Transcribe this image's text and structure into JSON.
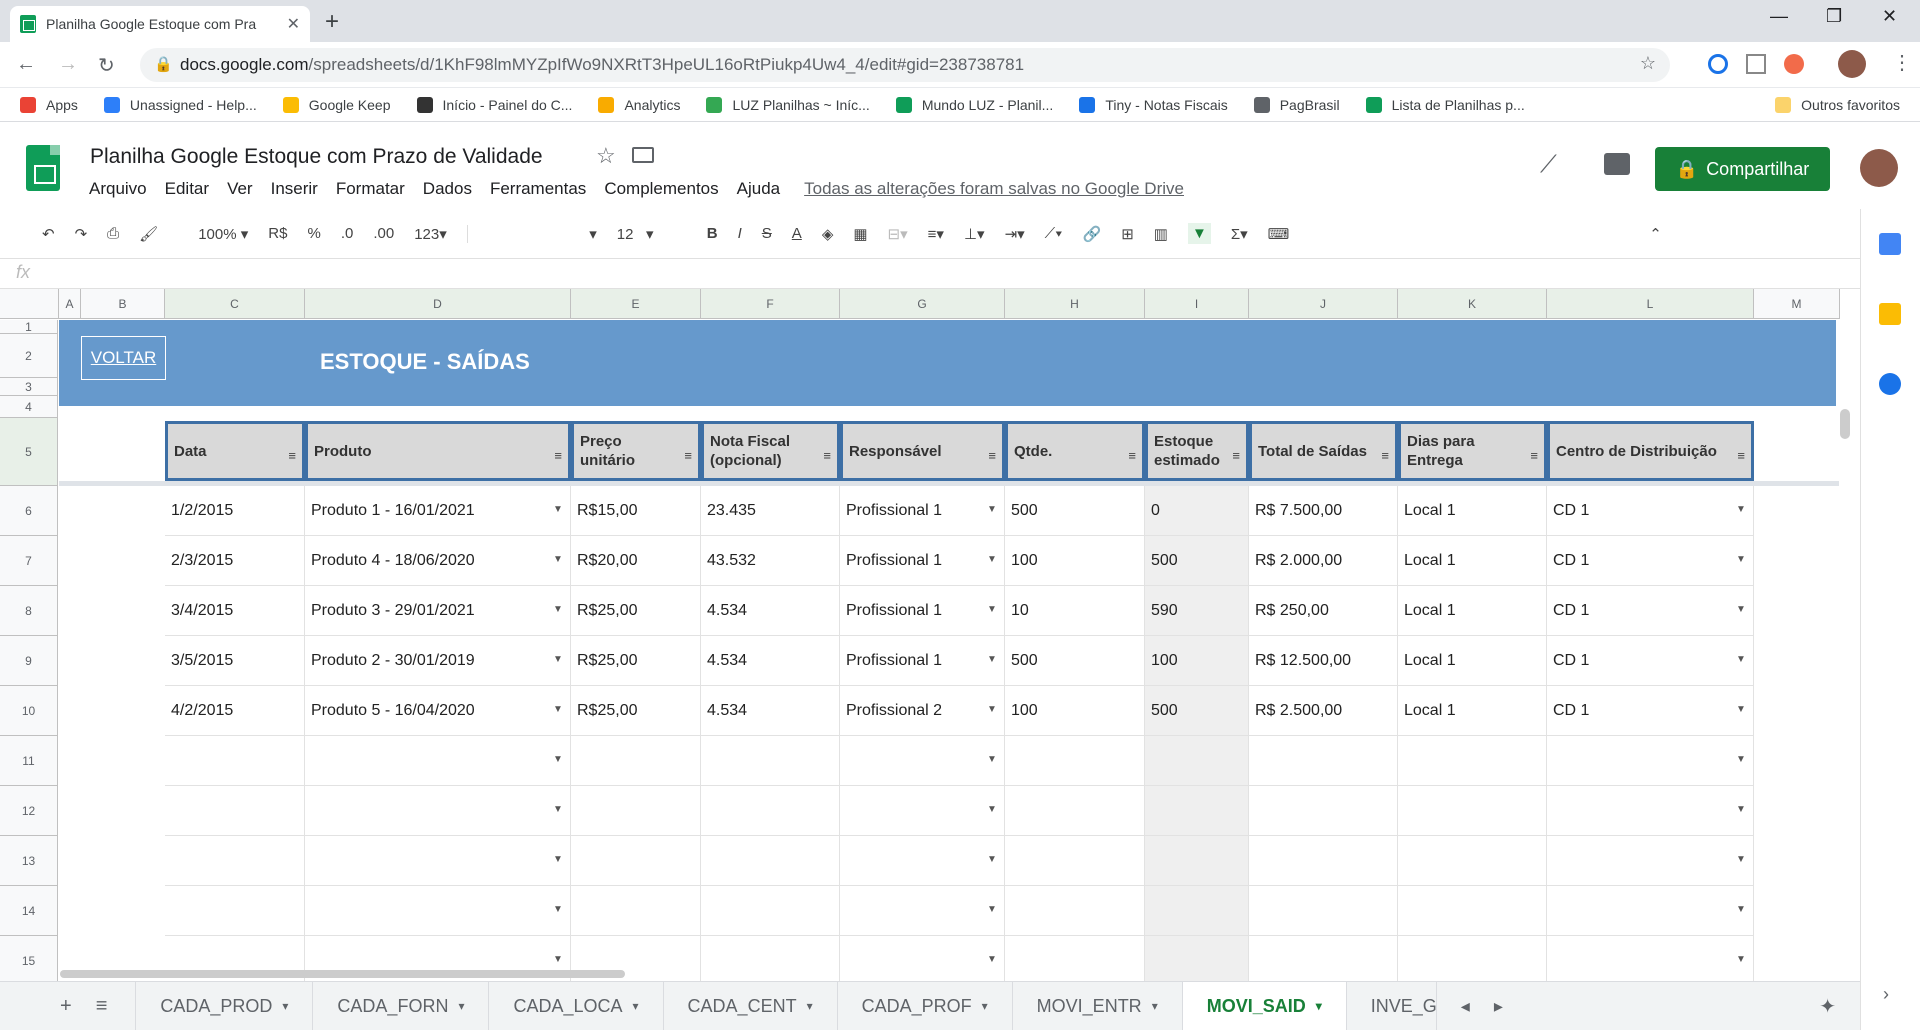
{
  "browser": {
    "tab_title": "Planilha Google Estoque com Pra",
    "url_host": "docs.google.com",
    "url_path": "/spreadsheets/d/1KhF98lmMYZpIfWo9NXRtT3HpeUL16oRtPiukp4Uw4_4/edit#gid=238738781"
  },
  "bookmarks": [
    {
      "label": "Apps",
      "color": "#ea4335"
    },
    {
      "label": "Unassigned - Help...",
      "color": "#2d7ff9"
    },
    {
      "label": "Google Keep",
      "color": "#fbbc04"
    },
    {
      "label": "Início - Painel do C...",
      "color": "#333333"
    },
    {
      "label": "Analytics",
      "color": "#f9ab00"
    },
    {
      "label": "LUZ Planilhas ~ Iníc...",
      "color": "#34a853"
    },
    {
      "label": "Mundo LUZ - Planil...",
      "color": "#0f9d58"
    },
    {
      "label": "Tiny - Notas Fiscais",
      "color": "#1a73e8"
    },
    {
      "label": "PagBrasil",
      "color": "#5f6368"
    },
    {
      "label": "Lista de Planilhas p...",
      "color": "#0f9d58"
    }
  ],
  "bookmarks_more": "Outros favoritos",
  "doc": {
    "title": "Planilha Google Estoque com Prazo de Validade",
    "menu": [
      "Arquivo",
      "Editar",
      "Ver",
      "Inserir",
      "Formatar",
      "Dados",
      "Ferramentas",
      "Complementos",
      "Ajuda"
    ],
    "saved": "Todas as alterações foram salvas no Google Drive",
    "share": "Compartilhar"
  },
  "toolbar": {
    "zoom": "100%",
    "currency": "R$",
    "percent": "%",
    "dec_less": ".0",
    "dec_more": ".00",
    "format": "123",
    "font_size": "12"
  },
  "fx_label": "fx",
  "columns": [
    "A",
    "B",
    "C",
    "D",
    "E",
    "F",
    "G",
    "H",
    "I",
    "J",
    "K",
    "L",
    "M"
  ],
  "rows": [
    "1",
    "2",
    "3",
    "4",
    "5",
    "6",
    "7",
    "8",
    "9",
    "10",
    "11",
    "12",
    "13",
    "14",
    "15"
  ],
  "band": {
    "button": "VOLTAR",
    "title": "ESTOQUE - SAÍDAS"
  },
  "headers": [
    "Data",
    "Produto",
    "Preço unitário",
    "Nota Fiscal (opcional)",
    "Responsável",
    "Qtde.",
    "Estoque estimado",
    "Total de Saídas",
    "Dias para Entrega",
    "Centro de Distribuição"
  ],
  "data": [
    [
      "1/2/2015",
      "Produto 1 - 16/01/2021",
      "R$15,00",
      "23.435",
      "Profissional 1",
      "500",
      "0",
      "R$ 7.500,00",
      "Local 1",
      "CD 1"
    ],
    [
      "2/3/2015",
      "Produto 4 - 18/06/2020",
      "R$20,00",
      "43.532",
      "Profissional 1",
      "100",
      "500",
      "R$ 2.000,00",
      "Local 1",
      "CD 1"
    ],
    [
      "3/4/2015",
      "Produto 3 - 29/01/2021",
      "R$25,00",
      "4.534",
      "Profissional 1",
      "10",
      "590",
      "R$ 250,00",
      "Local 1",
      "CD 1"
    ],
    [
      "3/5/2015",
      "Produto 2 - 30/01/2019",
      "R$25,00",
      "4.534",
      "Profissional 1",
      "500",
      "100",
      "R$ 12.500,00",
      "Local 1",
      "CD 1"
    ],
    [
      "4/2/2015",
      "Produto 5 - 16/04/2020",
      "R$25,00",
      "4.534",
      "Profissional 2",
      "100",
      "500",
      "R$ 2.500,00",
      "Local 1",
      "CD 1"
    ]
  ],
  "sheet_tabs": [
    "CADA_PROD",
    "CADA_FORN",
    "CADA_LOCA",
    "CADA_CENT",
    "CADA_PROF",
    "MOVI_ENTR",
    "MOVI_SAID",
    "INVE_GERA"
  ],
  "active_sheet": "MOVI_SAID"
}
